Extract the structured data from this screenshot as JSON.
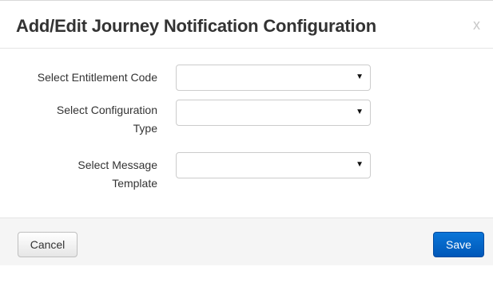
{
  "modal": {
    "title": "Add/Edit Journey Notification Configuration",
    "close_label": "x"
  },
  "form": {
    "fields": [
      {
        "label": "Select Entitlement Code",
        "value": "",
        "icon": "dropdown-arrow-icon"
      },
      {
        "label_line1": "Select Configuration",
        "label_line2": "Type",
        "value": "",
        "icon": "dropdown-arrow-icon"
      },
      {
        "label_line1": "Select Message",
        "label_line2": "Template",
        "value": "",
        "icon": "dropdown-arrow-icon"
      }
    ],
    "arrow_glyph": "▼"
  },
  "footer": {
    "cancel_label": "Cancel",
    "save_label": "Save"
  },
  "colors": {
    "primary_button": "#0a6bd0",
    "title_text": "#333333",
    "footer_bg": "#f5f5f5"
  }
}
